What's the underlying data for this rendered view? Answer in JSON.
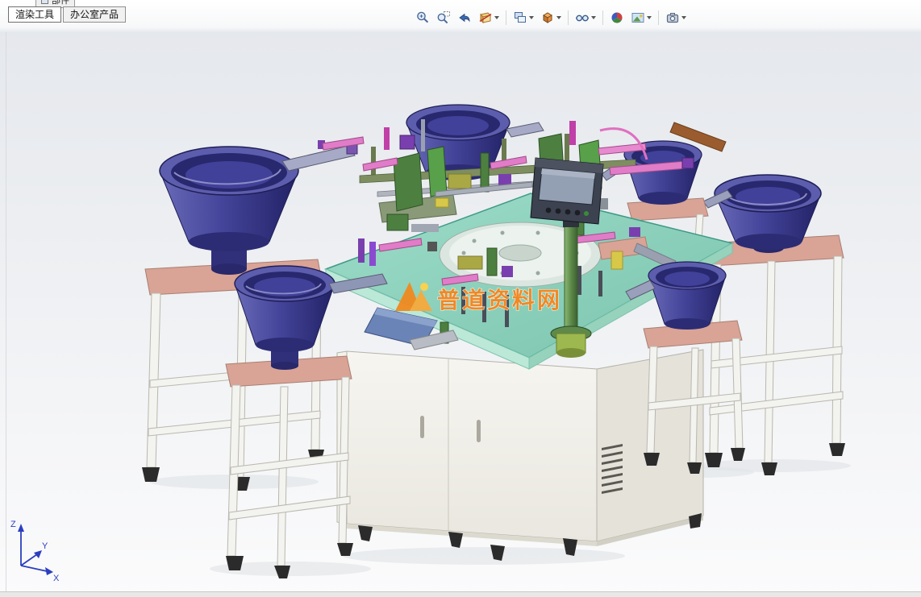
{
  "window": {
    "partial_tab": {
      "label": "部件"
    },
    "tabs": [
      {
        "id": "render-tools",
        "label": "渲染工具"
      },
      {
        "id": "office-products",
        "label": "办公室产品"
      }
    ]
  },
  "viewport_toolbar": {
    "icons": [
      {
        "name": "zoom-to-fit",
        "dropdown": false
      },
      {
        "name": "zoom-to-area",
        "dropdown": false
      },
      {
        "name": "previous-view",
        "dropdown": false
      },
      {
        "name": "section-view",
        "dropdown": true
      },
      {
        "name": "view-orientation",
        "dropdown": true
      },
      {
        "name": "display-style",
        "dropdown": true
      },
      {
        "name": "hide-show-items",
        "dropdown": true
      },
      {
        "name": "edit-appearance",
        "dropdown": false
      },
      {
        "name": "apply-scene",
        "dropdown": true
      },
      {
        "name": "view-settings",
        "dropdown": true
      }
    ]
  },
  "viewport": {
    "watermark": {
      "text": "普道资料网"
    },
    "triad": {
      "x_label": "X",
      "y_label": "Y",
      "z_label": "Z"
    },
    "colors": {
      "bowl-rim": "#5d5dae",
      "bowl-cavity": "#28286e",
      "bowl-inner": "#41419a",
      "bowl-base": "#30307a",
      "stand-top": "#d9a396",
      "stand-leg": "#f3f3ef",
      "cabinet": "#f3f2ec",
      "cabinet-shade": "#e4e2d9",
      "table-top": "#8fd4bf",
      "dial": "#ecf2ee",
      "fixture-green": "#4d8040",
      "fixture-pink": "#e07cc8",
      "fixture-purple": "#7a3fae",
      "fixture-olive": "#aaa845",
      "pole-green": "#5d8a4a",
      "hmi-body": "#3c4250",
      "hmi-screen": "#93a0b4",
      "watermark-orange": "#f5861f",
      "foot": "#2b2b2b",
      "triad-blue": "#2b3fbf"
    }
  }
}
